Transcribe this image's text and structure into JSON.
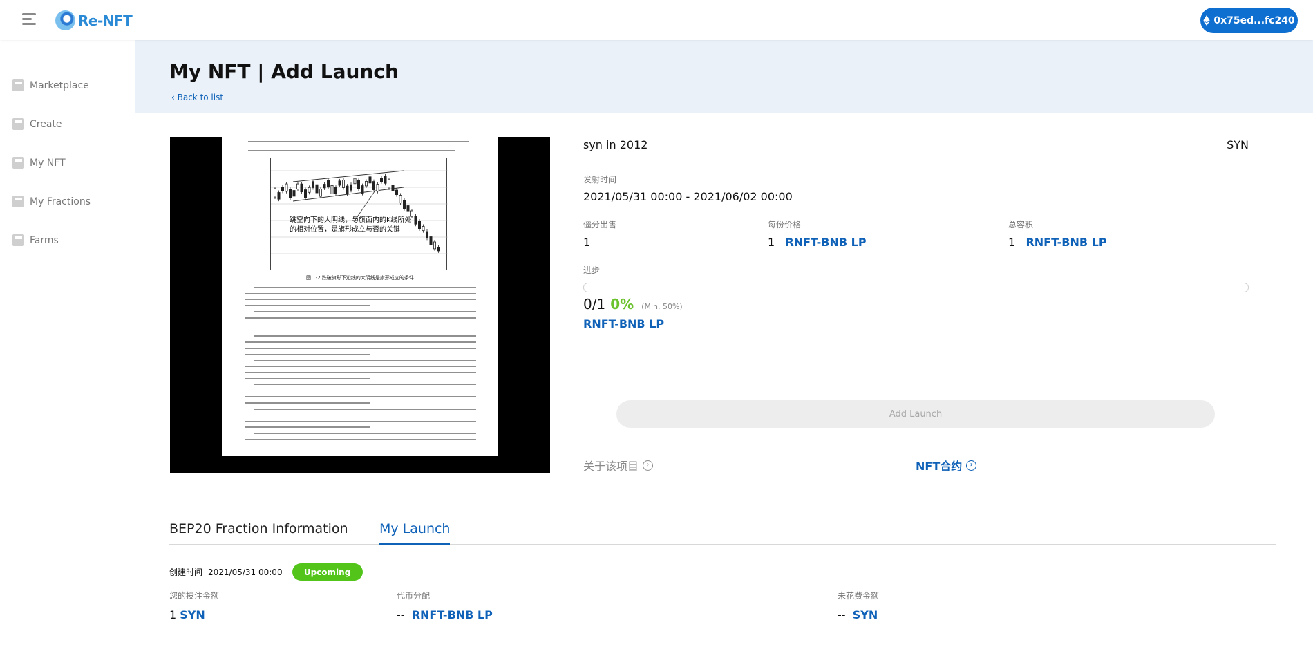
{
  "app": {
    "name": "Re-NFT",
    "wallet_address": "0x75ed...fc240"
  },
  "colors": {
    "primary": "#0f62b8",
    "success": "#52c41a",
    "hero_bg": "#eaf1f8"
  },
  "sidebar": {
    "items": [
      {
        "label": "Marketplace",
        "icon": "marketplace-icon"
      },
      {
        "label": "Create",
        "icon": "create-icon"
      },
      {
        "label": "My NFT",
        "icon": "my-nft-icon"
      },
      {
        "label": "My Fractions",
        "icon": "fractions-icon"
      },
      {
        "label": "Farms",
        "icon": "farms-icon"
      }
    ]
  },
  "header": {
    "title": "My NFT | Add Launch",
    "back_label": "Back to list"
  },
  "nft": {
    "name": "syn in 2012",
    "symbol": "SYN",
    "image": {
      "chart_caption": "跳空向下的大阴线，与旗面内的K线所处的相对位置，是旗形成立与否的关键",
      "figure_title": "图 1-2    跌破旗形下边线的大阴线是旗形成立的条件"
    }
  },
  "launch": {
    "time_label": "发射时间",
    "time_range": "2021/05/31 00:00 - 2021/06/02 00:00",
    "shares_label": "僵分出售",
    "shares_value": "1",
    "price_label": "每份价格",
    "price_amount": "1",
    "price_token": "RNFT-BNB LP",
    "total_label": "总容积",
    "total_amount": "1",
    "total_token": "RNFT-BNB LP",
    "progress_label": "进步",
    "progress_count": "0/1",
    "progress_percent": "0%",
    "progress_min": "(Min. 50%)",
    "progress_fraction": 0,
    "token_link": "RNFT-BNB LP",
    "add_button": "Add Launch",
    "about_label": "关于该项目",
    "contract_label": "NFT合约"
  },
  "tabs": [
    {
      "label": "BEP20 Fraction Information",
      "active": false
    },
    {
      "label": "My Launch",
      "active": true
    }
  ],
  "my_launch": {
    "created_label": "创建时间",
    "created_time": "2021/05/31 00:00",
    "status": "Upcoming",
    "bet_label": "您的投注金额",
    "bet_amount": "1",
    "bet_token": "SYN",
    "distribution_label": "代币分配",
    "distribution_amount": "--",
    "distribution_token": "RNFT-BNB LP",
    "unspent_label": "未花费金额",
    "unspent_amount": "--",
    "unspent_token": "SYN"
  }
}
